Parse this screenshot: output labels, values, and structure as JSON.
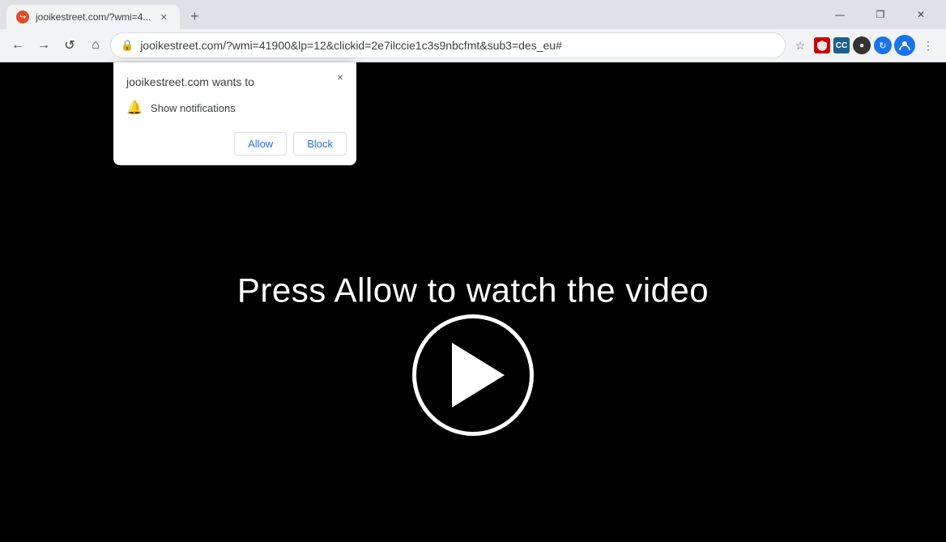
{
  "browser": {
    "tab": {
      "title": "jooikestreet.com/?wmi=4...",
      "url": "jooikestreet.com/?wmi=41900&lp=12&clickid=2e7ilccie1c3s9nbcfmt&sub3=des_eu#"
    },
    "new_tab_label": "+",
    "window_controls": {
      "minimize": "—",
      "maximize": "❐",
      "close": "✕"
    },
    "nav": {
      "back": "←",
      "forward": "→",
      "reload": "↺",
      "home": "⌂"
    },
    "toolbar": {
      "bookmark": "☆",
      "extensions_label": "Extensions",
      "menu": "⋮"
    }
  },
  "permission_dialog": {
    "title": "jooikestreet.com wants to",
    "close_icon": "×",
    "permission_text": "Show notifications",
    "bell_icon": "🔔",
    "allow_label": "Allow",
    "block_label": "Block"
  },
  "page_content": {
    "main_text": "Press Allow to watch the video"
  }
}
